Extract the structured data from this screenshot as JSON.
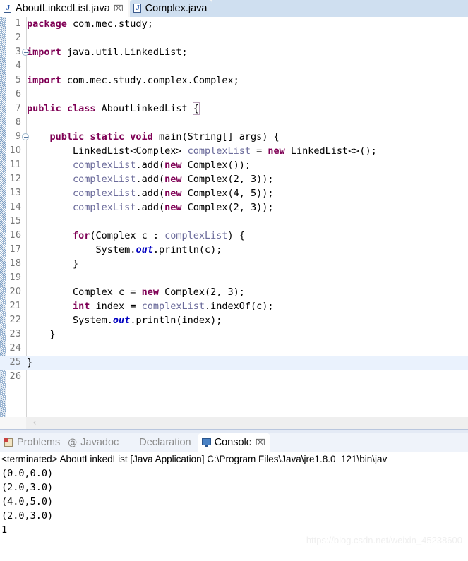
{
  "editor_tabs": [
    {
      "label": "AboutLinkedList.java",
      "icon": "java-file-icon",
      "active": true,
      "closable": true
    },
    {
      "label": "Complex.java",
      "icon": "java-file-icon",
      "active": false,
      "closable": false
    }
  ],
  "close_glyph": "⌧",
  "editor": {
    "current_line": 25,
    "lines": [
      {
        "n": "1",
        "fold": false,
        "tokens": [
          {
            "t": "package ",
            "c": "kw"
          },
          {
            "t": "com.mec.study;",
            "c": "plain"
          }
        ]
      },
      {
        "n": "2",
        "fold": false,
        "tokens": []
      },
      {
        "n": "3",
        "fold": true,
        "tokens": [
          {
            "t": "import ",
            "c": "kw"
          },
          {
            "t": "java.util.LinkedList;",
            "c": "plain"
          }
        ]
      },
      {
        "n": "4",
        "fold": false,
        "tokens": []
      },
      {
        "n": "5",
        "fold": false,
        "tokens": [
          {
            "t": "import ",
            "c": "kw"
          },
          {
            "t": "com.mec.study.complex.Complex;",
            "c": "plain"
          }
        ]
      },
      {
        "n": "6",
        "fold": false,
        "tokens": []
      },
      {
        "n": "7",
        "fold": false,
        "tokens": [
          {
            "t": "public class ",
            "c": "kw"
          },
          {
            "t": "AboutLinkedList ",
            "c": "plain"
          },
          {
            "t": "{",
            "c": "brace"
          }
        ]
      },
      {
        "n": "8",
        "fold": false,
        "tokens": []
      },
      {
        "n": "9",
        "fold": true,
        "tokens": [
          {
            "t": "    ",
            "c": "plain"
          },
          {
            "t": "public static void ",
            "c": "kw"
          },
          {
            "t": "main(String[] args) {",
            "c": "plain"
          }
        ]
      },
      {
        "n": "10",
        "fold": false,
        "tokens": [
          {
            "t": "        LinkedList<Complex> ",
            "c": "plain"
          },
          {
            "t": "complexList",
            "c": "lvar"
          },
          {
            "t": " = ",
            "c": "plain"
          },
          {
            "t": "new ",
            "c": "kw"
          },
          {
            "t": "LinkedList<>();",
            "c": "plain"
          }
        ]
      },
      {
        "n": "11",
        "fold": false,
        "tokens": [
          {
            "t": "        ",
            "c": "plain"
          },
          {
            "t": "complexList",
            "c": "lvar"
          },
          {
            "t": ".add(",
            "c": "plain"
          },
          {
            "t": "new ",
            "c": "kw"
          },
          {
            "t": "Complex());",
            "c": "plain"
          }
        ]
      },
      {
        "n": "12",
        "fold": false,
        "tokens": [
          {
            "t": "        ",
            "c": "plain"
          },
          {
            "t": "complexList",
            "c": "lvar"
          },
          {
            "t": ".add(",
            "c": "plain"
          },
          {
            "t": "new ",
            "c": "kw"
          },
          {
            "t": "Complex(2, 3));",
            "c": "plain"
          }
        ]
      },
      {
        "n": "13",
        "fold": false,
        "tokens": [
          {
            "t": "        ",
            "c": "plain"
          },
          {
            "t": "complexList",
            "c": "lvar"
          },
          {
            "t": ".add(",
            "c": "plain"
          },
          {
            "t": "new ",
            "c": "kw"
          },
          {
            "t": "Complex(4, 5));",
            "c": "plain"
          }
        ]
      },
      {
        "n": "14",
        "fold": false,
        "tokens": [
          {
            "t": "        ",
            "c": "plain"
          },
          {
            "t": "complexList",
            "c": "lvar"
          },
          {
            "t": ".add(",
            "c": "plain"
          },
          {
            "t": "new ",
            "c": "kw"
          },
          {
            "t": "Complex(2, 3));",
            "c": "plain"
          }
        ]
      },
      {
        "n": "15",
        "fold": false,
        "tokens": []
      },
      {
        "n": "16",
        "fold": false,
        "tokens": [
          {
            "t": "        ",
            "c": "plain"
          },
          {
            "t": "for",
            "c": "kw"
          },
          {
            "t": "(Complex c : ",
            "c": "plain"
          },
          {
            "t": "complexList",
            "c": "lvar"
          },
          {
            "t": ") {",
            "c": "plain"
          }
        ]
      },
      {
        "n": "17",
        "fold": false,
        "tokens": [
          {
            "t": "            System.",
            "c": "plain"
          },
          {
            "t": "out",
            "c": "sfld"
          },
          {
            "t": ".println(c);",
            "c": "plain"
          }
        ]
      },
      {
        "n": "18",
        "fold": false,
        "tokens": [
          {
            "t": "        }",
            "c": "plain"
          }
        ]
      },
      {
        "n": "19",
        "fold": false,
        "tokens": []
      },
      {
        "n": "20",
        "fold": false,
        "tokens": [
          {
            "t": "        Complex c = ",
            "c": "plain"
          },
          {
            "t": "new ",
            "c": "kw"
          },
          {
            "t": "Complex(2, 3);",
            "c": "plain"
          }
        ]
      },
      {
        "n": "21",
        "fold": false,
        "tokens": [
          {
            "t": "        ",
            "c": "plain"
          },
          {
            "t": "int ",
            "c": "kw"
          },
          {
            "t": "index = ",
            "c": "plain"
          },
          {
            "t": "complexList",
            "c": "lvar"
          },
          {
            "t": ".indexOf(c);",
            "c": "plain"
          }
        ]
      },
      {
        "n": "22",
        "fold": false,
        "tokens": [
          {
            "t": "        System.",
            "c": "plain"
          },
          {
            "t": "out",
            "c": "sfld"
          },
          {
            "t": ".println(index);",
            "c": "plain"
          }
        ]
      },
      {
        "n": "23",
        "fold": false,
        "tokens": [
          {
            "t": "    }",
            "c": "plain"
          }
        ]
      },
      {
        "n": "24",
        "fold": false,
        "tokens": []
      },
      {
        "n": "25",
        "fold": false,
        "tokens": [
          {
            "t": "}",
            "c": "plain"
          },
          {
            "t": "",
            "c": "cursor"
          }
        ]
      },
      {
        "n": "26",
        "fold": false,
        "tokens": []
      }
    ]
  },
  "hscroll": {
    "left_arrow": "‹"
  },
  "view_tabs": [
    {
      "label": "Problems",
      "icon": "problems-icon",
      "selected": false,
      "closable": false
    },
    {
      "label": "Javadoc",
      "icon": "javadoc-icon",
      "selected": false,
      "closable": false
    },
    {
      "label": "Declaration",
      "icon": "declaration-icon",
      "selected": false,
      "closable": false
    },
    {
      "label": "Console",
      "icon": "console-icon",
      "selected": true,
      "closable": true
    }
  ],
  "console": {
    "header": "<terminated> AboutLinkedList [Java Application] C:\\Program Files\\Java\\jre1.8.0_121\\bin\\jav",
    "output": [
      "(0.0,0.0)",
      "(2.0,3.0)",
      "(4.0,5.0)",
      "(2.0,3.0)",
      "1"
    ]
  },
  "watermark": "https://blog.csdn.net/weixin_45238600",
  "colors": {
    "keyword": "#7f0055",
    "local_variable": "#6a6a9a",
    "static_field": "#0000c0",
    "current_line_highlight": "#eaf2fd",
    "inactive_tab": "#cfdff0"
  }
}
